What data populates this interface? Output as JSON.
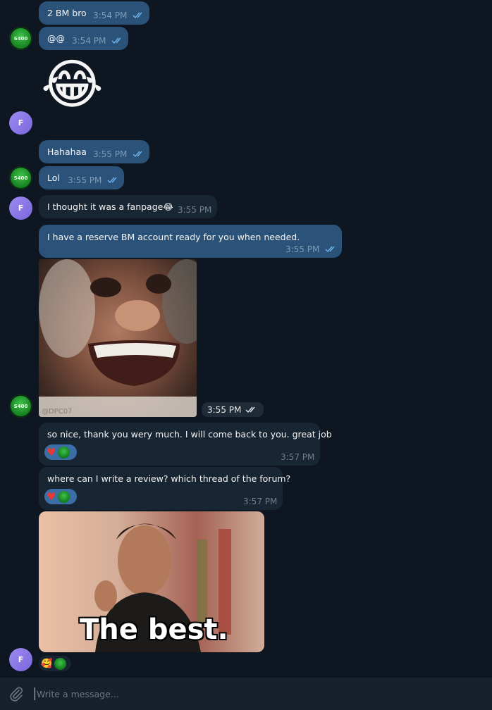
{
  "messages": {
    "m1": {
      "text": "2 BM bro",
      "time": "3:54 PM"
    },
    "m2": {
      "text": "@@",
      "time": "3:54 PM"
    },
    "m3": {
      "emoji": "😂"
    },
    "m4": {
      "text": "Hahahaa",
      "time": "3:55 PM"
    },
    "m5": {
      "text": "Lol",
      "time": "3:55 PM"
    },
    "m6": {
      "text": "I thought it was a fanpage😂",
      "time": "3:55 PM"
    },
    "m7": {
      "text": "I have a reserve BM account ready for you when needed.",
      "time": "3:55 PM"
    },
    "m8": {
      "watermark": "@DPC07",
      "time": "3:55 PM"
    },
    "m9": {
      "text": "so nice, thank you wery much. I will come back to you. great job",
      "time": "3:57 PM"
    },
    "m10": {
      "text": "where can I write a review? which thread of the forum?",
      "time": "3:57 PM"
    },
    "m11": {
      "caption": "The best."
    }
  },
  "avatars": {
    "f_initial": "F",
    "logo_text": "S400"
  },
  "reactions": {
    "heart": "♥",
    "fire": "🥰"
  },
  "composer": {
    "placeholder": "Write a message..."
  },
  "colors": {
    "background": "#0e1621",
    "outgoing": "#2b5278",
    "incoming": "#182533",
    "accent": "#3a6ea5"
  }
}
